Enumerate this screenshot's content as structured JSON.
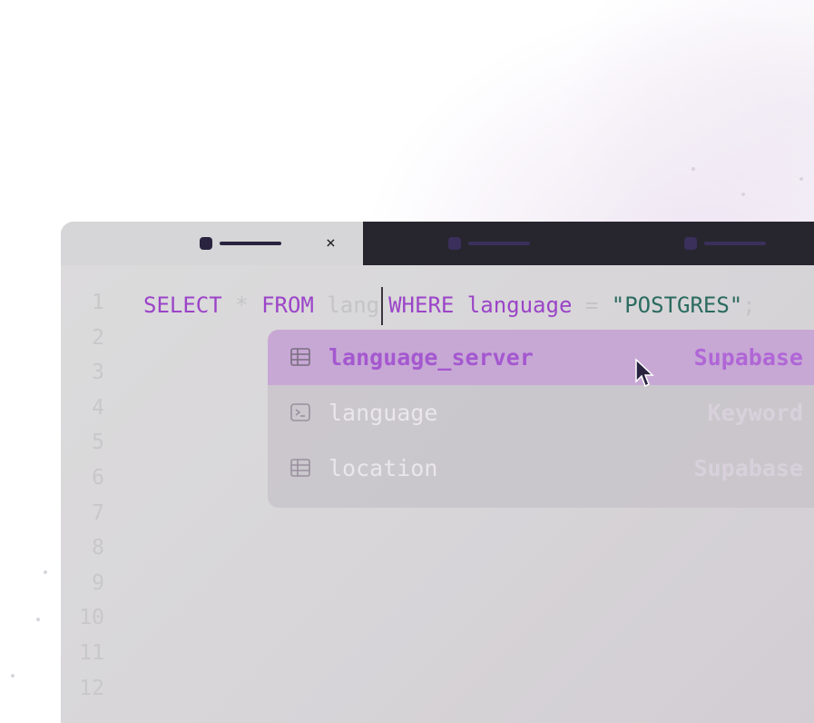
{
  "editor": {
    "line_numbers": [
      "1",
      "2",
      "3",
      "4",
      "5",
      "6",
      "7",
      "8",
      "9",
      "10",
      "11",
      "12"
    ],
    "code": {
      "kw_select": "SELECT",
      "star": " * ",
      "kw_from": "FROM",
      "typed": " lang",
      "kw_where": "WHERE",
      "ident": " language ",
      "op": "= ",
      "string": "\"POSTGRES\"",
      "semi": ";"
    },
    "tabs": [
      {
        "state": "active",
        "close_icon": "×"
      },
      {
        "state": "inactive"
      },
      {
        "state": "inactive"
      }
    ]
  },
  "autocomplete": {
    "items": [
      {
        "icon": "table-icon",
        "label": "language_server",
        "detail": "Supabase",
        "selected": true
      },
      {
        "icon": "terminal-icon",
        "label": "language",
        "detail": "Keyword",
        "selected": false
      },
      {
        "icon": "table-icon",
        "label": "location",
        "detail": "Supabase",
        "selected": false
      }
    ]
  },
  "colors": {
    "keyword": "#9b44c8",
    "string": "#2b6b60",
    "selection": "#c7a8d5",
    "dark_tab": "#27262f"
  }
}
